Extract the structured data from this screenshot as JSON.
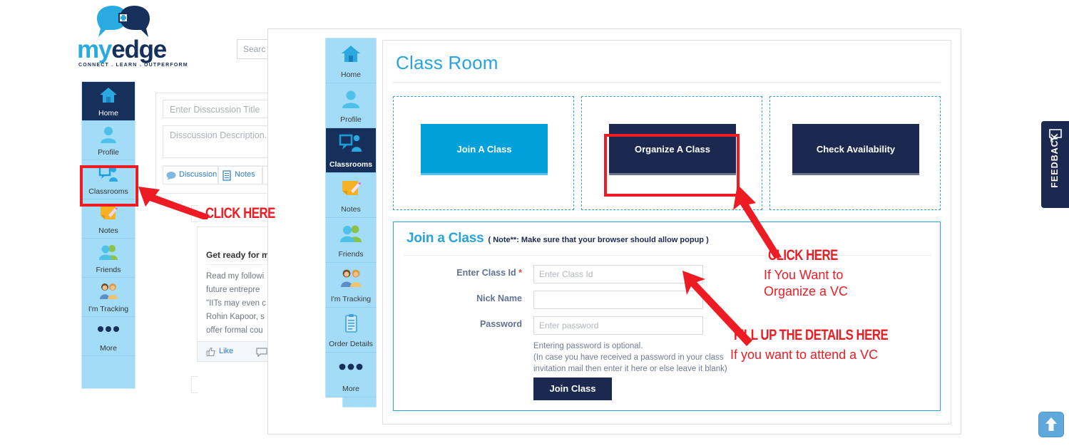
{
  "brand": {
    "name_part1": "my",
    "name_part2": "edge",
    "tagline": "CONNECT . LEARN . OUTPERFORM",
    "logo_icon": "two-heads-puzzle-icon",
    "colors": {
      "cyan": "#29ABE2",
      "navy": "#16305B"
    }
  },
  "background_page": {
    "search": {
      "placeholder": "Search",
      "value": "Searc"
    },
    "sidebar": {
      "items": [
        {
          "label": "Home",
          "icon": "home-icon",
          "active": true
        },
        {
          "label": "Profile",
          "icon": "user-icon",
          "active": false
        },
        {
          "label": "Classrooms",
          "icon": "classroom-icon",
          "active": false
        },
        {
          "label": "Notes",
          "icon": "notes-pencil-icon",
          "active": false
        },
        {
          "label": "Friends",
          "icon": "friends-icon",
          "active": false
        },
        {
          "label": "I'm Tracking",
          "icon": "tracking-people-icon",
          "active": false
        },
        {
          "label": "More",
          "icon": "ellipsis-icon",
          "active": false
        }
      ]
    },
    "discussion_composer": {
      "title_placeholder": "Enter Disscussion Title",
      "description_placeholder": "Disscussion Description...",
      "tabs": [
        {
          "label": "Discussion",
          "icon": "chat-bubble-icon"
        },
        {
          "label": "Notes",
          "icon": "notes-icon"
        }
      ]
    },
    "post": {
      "title": "Get ready for m",
      "body_lines": [
        "Read my followi",
        "future entrepre",
        "\"IITs may even c",
        "Rohin Kapoor, s",
        "offer formal cou"
      ],
      "actions": [
        {
          "label": "Like",
          "icon": "thumbs-up-icon"
        },
        {
          "label": "Com",
          "icon": "comment-icon"
        }
      ]
    }
  },
  "overlay": {
    "sidebar": {
      "items": [
        {
          "label": "Home",
          "icon": "home-icon",
          "active": false
        },
        {
          "label": "Profile",
          "icon": "user-icon",
          "active": false
        },
        {
          "label": "Classrooms",
          "icon": "classroom-icon",
          "active": true
        },
        {
          "label": "Notes",
          "icon": "notes-pencil-icon",
          "active": false
        },
        {
          "label": "Friends",
          "icon": "friends-icon",
          "active": false
        },
        {
          "label": "I'm Tracking",
          "icon": "tracking-people-icon",
          "active": false
        },
        {
          "label": "Order Details",
          "icon": "clipboard-icon",
          "active": false
        },
        {
          "label": "More",
          "icon": "ellipsis-icon",
          "active": false
        }
      ]
    },
    "page_title": "Class Room",
    "action_cards": [
      {
        "label": "Join A Class",
        "style": "cyan",
        "highlighted": false
      },
      {
        "label": "Organize A Class",
        "style": "navy",
        "highlighted": true
      },
      {
        "label": "Check Availability",
        "style": "navy",
        "highlighted": false
      }
    ],
    "join_form": {
      "heading": "Join a Class",
      "note": "( Note**: Make sure that your browser should allow popup )",
      "fields": [
        {
          "label": "Enter Class Id",
          "required": true,
          "placeholder": "Enter Class Id",
          "value": ""
        },
        {
          "label": "Nick Name",
          "required": false,
          "placeholder": "",
          "value": ""
        },
        {
          "label": "Password",
          "required": false,
          "placeholder": "Enter password",
          "value": ""
        }
      ],
      "help_line1": "Entering password is optional.",
      "help_line2": "(In case you have received a password in your class",
      "help_line3": "invitation mail then enter it here or else leave it blank)",
      "submit_label": "Join Class"
    }
  },
  "annotations": [
    {
      "id": "click-here-classrooms",
      "text": "CLICK HERE",
      "style": "condensed"
    },
    {
      "id": "click-here-organize",
      "text": "CLICK HERE",
      "style": "condensed"
    },
    {
      "id": "organize-line1",
      "text": "If You Want to",
      "style": "normal"
    },
    {
      "id": "organize-line2",
      "text": "Organize a VC",
      "style": "normal"
    },
    {
      "id": "fill-details",
      "text": "FILL UP THE DETAILS HERE",
      "style": "condensed"
    },
    {
      "id": "fill-details-sub",
      "text": "If you want to attend a VC",
      "style": "normal"
    }
  ],
  "widgets": {
    "feedback_label": "FEEDBACK",
    "feedback_icon": "speech-bubble-icon",
    "scroll_top_icon": "arrow-up-icon"
  },
  "colors": {
    "accent_cyan": "#00A0DB",
    "navy": "#1B2951",
    "annotation_red": "#ED1C24",
    "nav_blue": "#A3DCF7"
  }
}
